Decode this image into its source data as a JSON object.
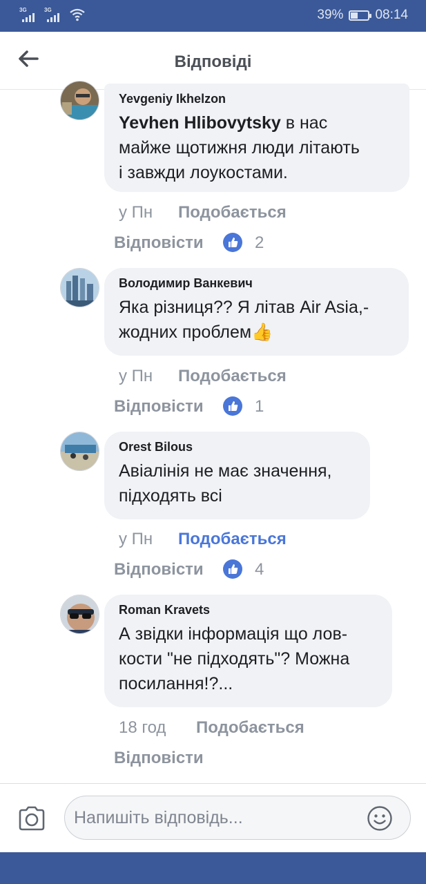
{
  "status_bar": {
    "network_1": "3G",
    "network_2": "3G",
    "battery_text": "39%",
    "battery_level": 0.39,
    "time": "08:14"
  },
  "header": {
    "title": "Відповіді",
    "back_icon": "arrow-left-icon"
  },
  "comments": [
    {
      "author": "Yevgeniy Ikhelzon",
      "mention": "Yevhen Hlibovytsky",
      "text": " в нас\nмайже щотижня люди літають\nі завжди лоукостами.",
      "time": "у Пн",
      "like_label": "Подобається",
      "like_active": false,
      "reply_label": "Відповісти",
      "reactions": "2"
    },
    {
      "author": "Володимир Ванкевич",
      "text": "Яка різниця?? Я літав Air Asia,-\nжодних проблем👍",
      "time": "у Пн",
      "like_label": "Подобається",
      "like_active": false,
      "reply_label": "Відповісти",
      "reactions": "1"
    },
    {
      "author": "Orest Bilous",
      "text": "Авіалінія не має значення,\nпідходять всі",
      "time": "у Пн",
      "like_label": "Подобається",
      "like_active": true,
      "reply_label": "Відповісти",
      "reactions": "4"
    },
    {
      "author": "Roman Kravets",
      "text": "А звідки інформація що лов-\nкости \"не підходять\"? Можна\nпосилання!?...",
      "time": "18 год",
      "like_label": "Подобається",
      "like_active": false,
      "reply_label": "Відповісти"
    }
  ],
  "composer": {
    "placeholder": "Напишіть відповідь...",
    "camera_icon": "camera-icon",
    "emoji_icon": "smiley-icon"
  },
  "colors": {
    "brand": "#3b5998",
    "like_active": "#4a76d8",
    "muted": "#8d949e"
  }
}
